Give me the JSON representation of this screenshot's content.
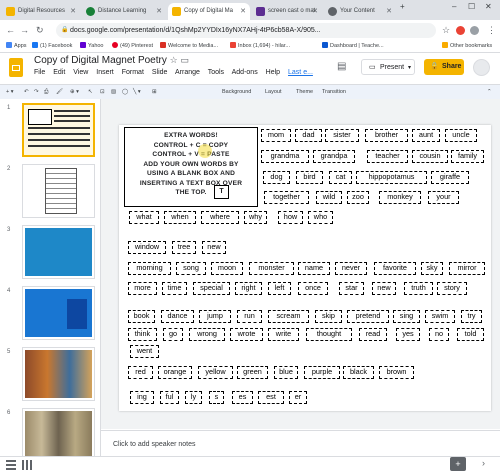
{
  "browser": {
    "tabs": [
      {
        "title": "Digital Resources",
        "active": false,
        "color": "#f4b400"
      },
      {
        "title": "Distance Learning",
        "active": false,
        "color": "#188038"
      },
      {
        "title": "Copy of Digital Ma",
        "active": true,
        "color": "#f4b400"
      },
      {
        "title": "screen cast o mat",
        "active": false,
        "color": "#5c2d91"
      },
      {
        "title": "Your Content",
        "active": false,
        "color": "#5f6368"
      }
    ],
    "url": "docs.google.com/presentation/d/1QshMp2YYDIx16yNX7AHj-4tP6cb58A-X/905...",
    "bookmarks": [
      "Apps",
      "(1) Facebook",
      "Yahoo",
      "(49) Pinterest",
      "Welcome to Media...",
      "Inbox (1,694) - hilar...",
      "Dashboard | Teache..."
    ],
    "other_bookmarks": "Other bookmarks"
  },
  "app": {
    "title": "Copy of Digital Magnet Poetry",
    "menus": [
      "File",
      "Edit",
      "View",
      "Insert",
      "Format",
      "Slide",
      "Arrange",
      "Tools",
      "Add-ons",
      "Help"
    ],
    "last_edit": "Last e...",
    "present_label": "Present",
    "share_label": "Share",
    "toolbar": {
      "background": "Background",
      "layout": "Layout",
      "theme": "Theme",
      "transition": "Transition"
    },
    "accent": "#f4b400"
  },
  "filmstrip": {
    "slide_numbers": [
      "1",
      "2",
      "3",
      "4",
      "5",
      "6"
    ],
    "selected": "1"
  },
  "slide": {
    "instructions": [
      "EXTRA WORDS!",
      "CONTROL + C = COPY",
      "CONTROL + V = PASTE",
      "ADD YOUR OWN WORDS BY",
      "USING A BLANK BOX AND",
      "INSERTING A TEXT BOX OVER",
      "THE TOP."
    ],
    "instruction_box_letter": "T",
    "words": {
      "r1": [
        "mom",
        "dad",
        "sister",
        "brother",
        "aunt",
        "uncle"
      ],
      "r2": [
        "grandma",
        "grandpa",
        "teacher",
        "cousin",
        "family"
      ],
      "r3": [
        "dog",
        "bird",
        "cat",
        "hippopotamus",
        "giraffe"
      ],
      "r4": [
        "together",
        "wild",
        "zoo",
        "monkey",
        "your"
      ],
      "r5": [
        "what",
        "when",
        "where",
        "why",
        "how",
        "who"
      ],
      "r6": [
        "window",
        "tree",
        "new"
      ],
      "r7": [
        "morning",
        "song",
        "moon",
        "monster",
        "name",
        "never",
        "favorite",
        "sky",
        "mirror"
      ],
      "r8": [
        "more",
        "time",
        "special",
        "right",
        "left",
        "once",
        "star",
        "new",
        "truth",
        "story"
      ],
      "r9": [
        "book",
        "dance",
        "jump",
        "run",
        "scream",
        "skip",
        "pretend",
        "sing",
        "swim",
        "try"
      ],
      "r10": [
        "think",
        "go",
        "wrong",
        "wrote",
        "write",
        "thought",
        "read",
        "yes",
        "no",
        "told"
      ],
      "r11": [
        "went"
      ],
      "r12": [
        "red",
        "orange",
        "yellow",
        "green",
        "blue",
        "purple",
        "black",
        "brown"
      ],
      "r13": [
        "ing",
        "ful",
        "ly",
        "s",
        "es",
        "est",
        "er"
      ]
    }
  },
  "notes_placeholder": "Click to add speaker notes"
}
